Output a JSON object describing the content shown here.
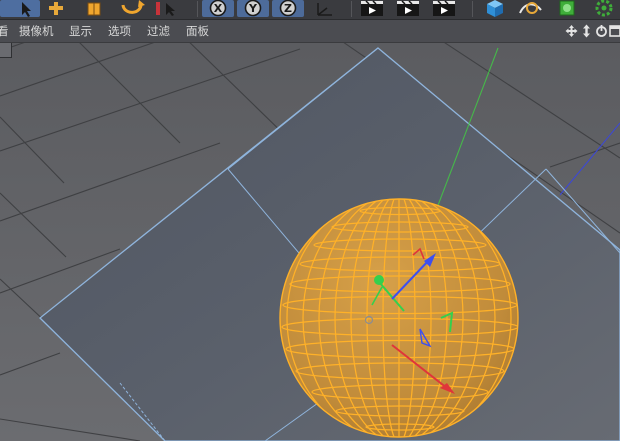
{
  "menubar": {
    "items": [
      {
        "label": "看"
      },
      {
        "label": "摄像机"
      },
      {
        "label": "显示"
      },
      {
        "label": "选项"
      },
      {
        "label": "过滤"
      },
      {
        "label": "面板"
      }
    ]
  },
  "toolbar": {
    "axis_lock_labels": [
      "X",
      "Y",
      "Z"
    ]
  },
  "colors": {
    "toolbar_bg": "#3a3b3f",
    "menubar_bg": "#4b4c51",
    "viewport_bg": "#5d5e62",
    "plane_fill": "#5a5f68",
    "plane_edge": "#8fb4dc",
    "sphere_fill": "#c48f3e",
    "sphere_wire": "#ffb128",
    "axis_x": "#e0353a",
    "axis_y": "#35d04d",
    "axis_z": "#3d4ff0"
  },
  "icons": {
    "nav": [
      "move-view-icon",
      "dolly-view-icon",
      "rotate-view-icon",
      "maximize-view-icon"
    ]
  }
}
